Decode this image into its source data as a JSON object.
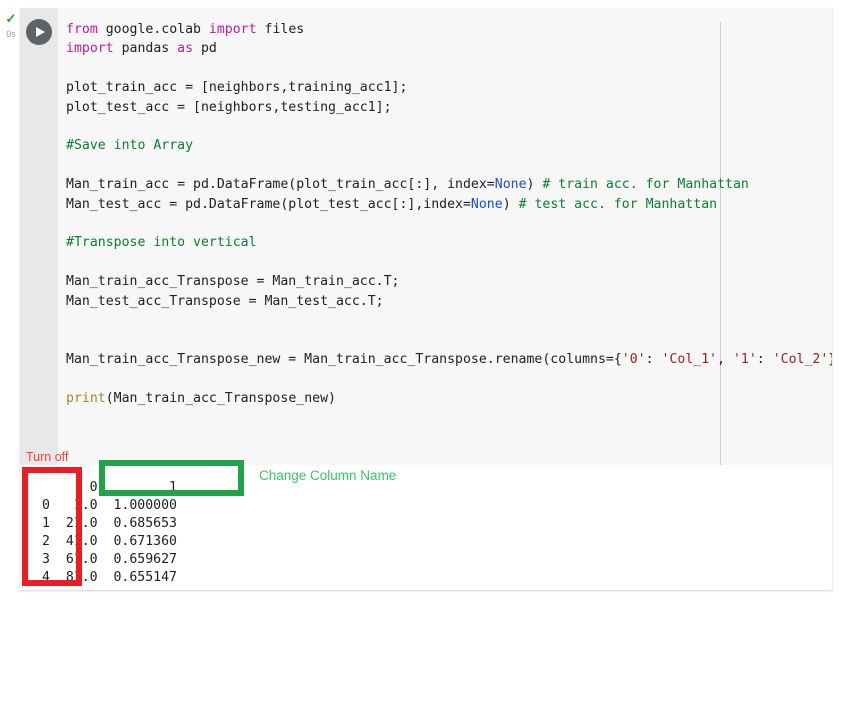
{
  "cell": {
    "status_check": "✓",
    "elapsed": "0s",
    "run_button_label": "run-cell"
  },
  "code": {
    "lines": [
      [
        {
          "t": "from ",
          "c": "kw"
        },
        {
          "t": "google.colab ",
          "c": ""
        },
        {
          "t": "import ",
          "c": "kw"
        },
        {
          "t": "files",
          "c": ""
        }
      ],
      [
        {
          "t": "import ",
          "c": "kw"
        },
        {
          "t": "pandas ",
          "c": ""
        },
        {
          "t": "as ",
          "c": "kw"
        },
        {
          "t": "pd",
          "c": ""
        }
      ],
      [],
      [
        {
          "t": "plot_train_acc = [neighbors,training_acc1];",
          "c": ""
        }
      ],
      [
        {
          "t": "plot_test_acc = [neighbors,testing_acc1];",
          "c": ""
        }
      ],
      [],
      [
        {
          "t": "#Save into Array",
          "c": "cm"
        }
      ],
      [],
      [
        {
          "t": "Man_train_acc = pd.DataFrame(plot_train_acc[:], index=",
          "c": ""
        },
        {
          "t": "None",
          "c": "num"
        },
        {
          "t": ") ",
          "c": ""
        },
        {
          "t": "# train acc. for Manhattan",
          "c": "cm"
        }
      ],
      [
        {
          "t": "Man_test_acc = pd.DataFrame(plot_test_acc[:],index=",
          "c": ""
        },
        {
          "t": "None",
          "c": "num"
        },
        {
          "t": ") ",
          "c": ""
        },
        {
          "t": "# test acc. for Manhattan",
          "c": "cm"
        }
      ],
      [],
      [
        {
          "t": "#Transpose into vertical",
          "c": "cm"
        }
      ],
      [],
      [
        {
          "t": "Man_train_acc_Transpose = Man_train_acc.T;",
          "c": ""
        }
      ],
      [
        {
          "t": "Man_test_acc_Transpose = Man_test_acc.T;",
          "c": ""
        }
      ],
      [],
      [],
      [
        {
          "t": "Man_train_acc_Transpose_new = Man_train_acc_Transpose.rename(columns={",
          "c": ""
        },
        {
          "t": "'0'",
          "c": "str"
        },
        {
          "t": ": ",
          "c": ""
        },
        {
          "t": "'Col_1'",
          "c": "str"
        },
        {
          "t": ", ",
          "c": ""
        },
        {
          "t": "'1'",
          "c": "str"
        },
        {
          "t": ": ",
          "c": ""
        },
        {
          "t": "'Col_2'",
          "c": "str"
        },
        {
          "t": "})",
          "c": ""
        }
      ],
      [],
      [
        {
          "t": "print",
          "c": "bi"
        },
        {
          "t": "(Man_train_acc_Transpose_new)",
          "c": ""
        }
      ]
    ]
  },
  "output": {
    "header_row": "      0         1",
    "rows": [
      "0   1.0  1.000000",
      "1  21.0  0.685653",
      "2  41.0  0.671360",
      "3  61.0  0.659627",
      "4  81.0  0.655147"
    ],
    "text": "      0         1\n0   1.0  1.000000\n1  21.0  0.685653\n2  41.0  0.671360\n3  61.0  0.659627\n4  81.0  0.655147"
  },
  "annotations": {
    "turn_off_label": "Turn off",
    "change_column_label": "Change Column Name",
    "red_color": "#ed1c24",
    "green_color": "#22a34a",
    "green_text_color": "#3cc36a",
    "red_text_color": "#f4433a"
  },
  "chart_data": {
    "type": "table",
    "title": "Man_train_acc_Transpose_new",
    "index": [
      "0",
      "1",
      "2",
      "3",
      "4"
    ],
    "columns": [
      "0",
      "1"
    ],
    "rows": [
      [
        "1.0",
        "1.000000"
      ],
      [
        "21.0",
        "0.685653"
      ],
      [
        "41.0",
        "0.671360"
      ],
      [
        "61.0",
        "0.659627"
      ],
      [
        "81.0",
        "0.655147"
      ]
    ],
    "series": [
      {
        "name": "0",
        "values": [
          1.0,
          21.0,
          41.0,
          61.0,
          81.0
        ]
      },
      {
        "name": "1",
        "values": [
          1.0,
          0.685653,
          0.67136,
          0.659627,
          0.655147
        ]
      }
    ]
  }
}
